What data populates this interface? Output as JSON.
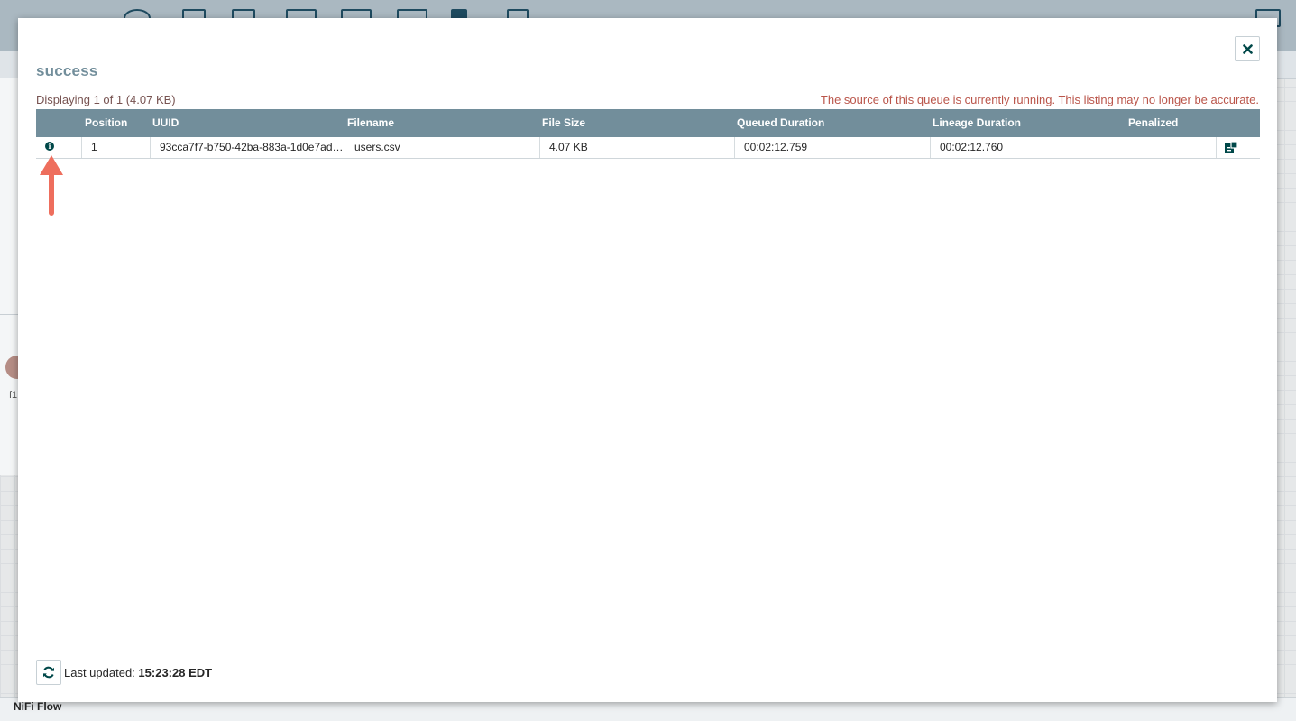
{
  "dialog": {
    "title": "success",
    "display_summary": "Displaying 1 of 1 (4.07 KB)",
    "warning": "The source of this queue is currently running. This listing may no longer be accurate.",
    "close_icon": "close-icon"
  },
  "table": {
    "columns": [
      "Position",
      "UUID",
      "Filename",
      "File Size",
      "Queued Duration",
      "Lineage Duration",
      "Penalized"
    ],
    "rows": [
      {
        "position": "1",
        "uuid": "93cca7f7-b750-42ba-883a-1d0e7ad…",
        "filename": "users.csv",
        "file_size": "4.07 KB",
        "queued_duration": "00:02:12.759",
        "lineage_duration": "00:02:12.760",
        "penalized": ""
      }
    ]
  },
  "footer": {
    "last_updated_label": "Last updated:",
    "last_updated_time": "15:23:28 EDT",
    "refresh_icon": "refresh-icon"
  },
  "background": {
    "breadcrumb": "NiFi Flow",
    "avatar_label": "f1"
  },
  "colors": {
    "header_bg": "#728e9b",
    "title": "#728e9b",
    "warning": "#ba554a",
    "icon": "#004849",
    "annotation_arrow": "#ee6e5d"
  }
}
